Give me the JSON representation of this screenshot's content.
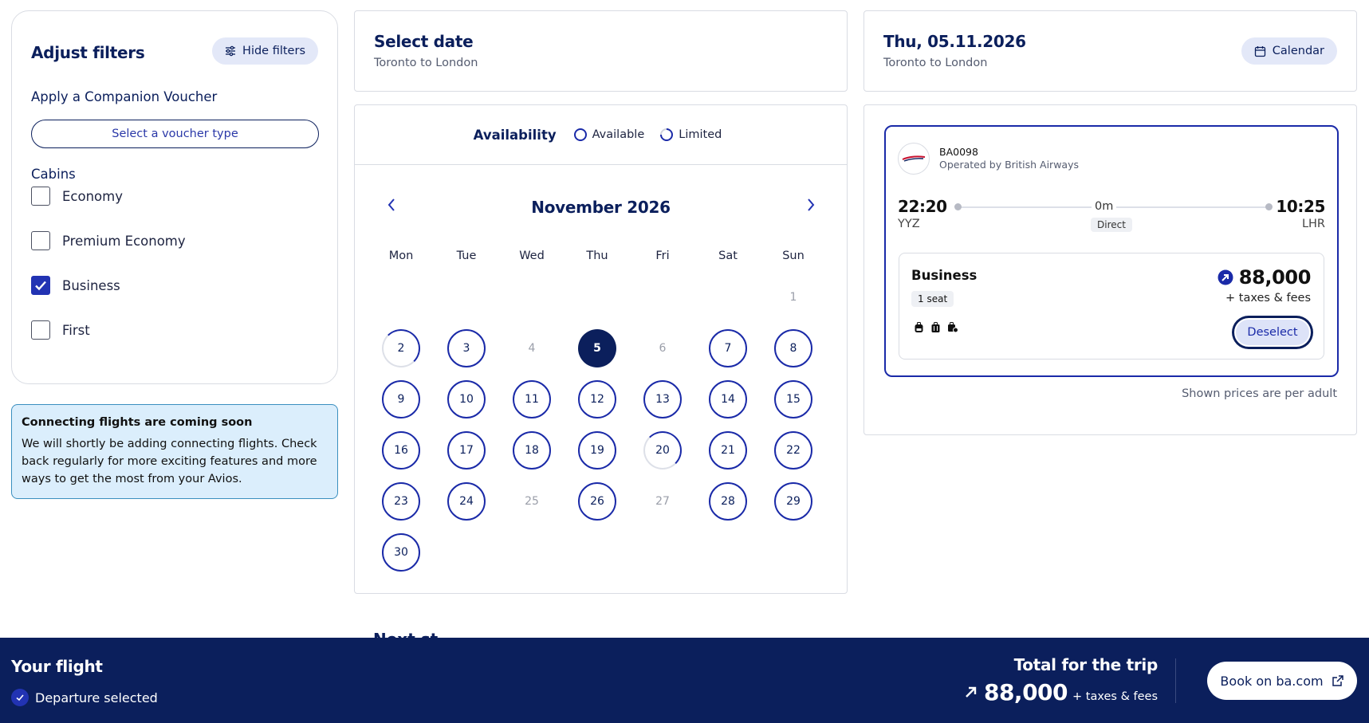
{
  "filters": {
    "title": "Adjust filters",
    "hide_label": "Hide filters",
    "voucher_title": "Apply a Companion Voucher",
    "voucher_btn": "Select a voucher type",
    "cabins_title": "Cabins",
    "cabins": [
      {
        "label": "Economy",
        "checked": false
      },
      {
        "label": "Premium Economy",
        "checked": false
      },
      {
        "label": "Business",
        "checked": true
      },
      {
        "label": "First",
        "checked": false
      }
    ]
  },
  "banner": {
    "title": "Connecting flights are coming soon",
    "body": "We will shortly be adding connecting flights. Check back regularly for more exciting features and more ways to get the most from your Avios."
  },
  "select_date": {
    "title": "Select date",
    "route": "Toronto to London"
  },
  "calendar": {
    "availability_label": "Availability",
    "legend_available": "Available",
    "legend_limited": "Limited",
    "month": "November 2026",
    "weekdays": [
      "Mon",
      "Tue",
      "Wed",
      "Thu",
      "Fri",
      "Sat",
      "Sun"
    ],
    "days": [
      {
        "d": "1",
        "s": "none"
      },
      {
        "d": "2",
        "s": "limited"
      },
      {
        "d": "3",
        "s": "avail"
      },
      {
        "d": "4",
        "s": "none"
      },
      {
        "d": "5",
        "s": "selected"
      },
      {
        "d": "6",
        "s": "none"
      },
      {
        "d": "7",
        "s": "avail"
      },
      {
        "d": "8",
        "s": "avail"
      },
      {
        "d": "9",
        "s": "avail"
      },
      {
        "d": "10",
        "s": "avail"
      },
      {
        "d": "11",
        "s": "avail"
      },
      {
        "d": "12",
        "s": "avail"
      },
      {
        "d": "13",
        "s": "avail"
      },
      {
        "d": "14",
        "s": "avail"
      },
      {
        "d": "15",
        "s": "avail"
      },
      {
        "d": "16",
        "s": "avail"
      },
      {
        "d": "17",
        "s": "avail"
      },
      {
        "d": "18",
        "s": "avail"
      },
      {
        "d": "19",
        "s": "avail"
      },
      {
        "d": "20",
        "s": "limited"
      },
      {
        "d": "21",
        "s": "avail"
      },
      {
        "d": "22",
        "s": "avail"
      },
      {
        "d": "23",
        "s": "avail"
      },
      {
        "d": "24",
        "s": "avail"
      },
      {
        "d": "25",
        "s": "none"
      },
      {
        "d": "26",
        "s": "avail"
      },
      {
        "d": "27",
        "s": "none"
      },
      {
        "d": "28",
        "s": "avail"
      },
      {
        "d": "29",
        "s": "avail"
      },
      {
        "d": "30",
        "s": "avail"
      }
    ]
  },
  "flight_head": {
    "date": "Thu, 05.11.2026",
    "route": "Toronto to London",
    "calendar_label": "Calendar"
  },
  "flight": {
    "number": "BA0098",
    "operated": "Operated by British Airways",
    "dep_time": "22:20",
    "dep_airport": "YYZ",
    "arr_time": "10:25",
    "arr_airport": "LHR",
    "duration": "0m",
    "stops": "Direct",
    "cabin": "Business",
    "seats": "1 seat",
    "price": "88,000",
    "taxes": "+ taxes & fees",
    "deselect": "Deselect",
    "note": "Shown prices are per adult"
  },
  "next_peek": "Next st",
  "footer": {
    "your_flight": "Your flight",
    "departure": "Departure selected",
    "total_label": "Total for the trip",
    "total_price": "88,000",
    "total_tax": "+ taxes & fees",
    "book": "Book on ba.com"
  },
  "colors": {
    "navy": "#0b1f5c",
    "accent": "#1a2aa8",
    "banner_bg": "#dbeefc"
  }
}
